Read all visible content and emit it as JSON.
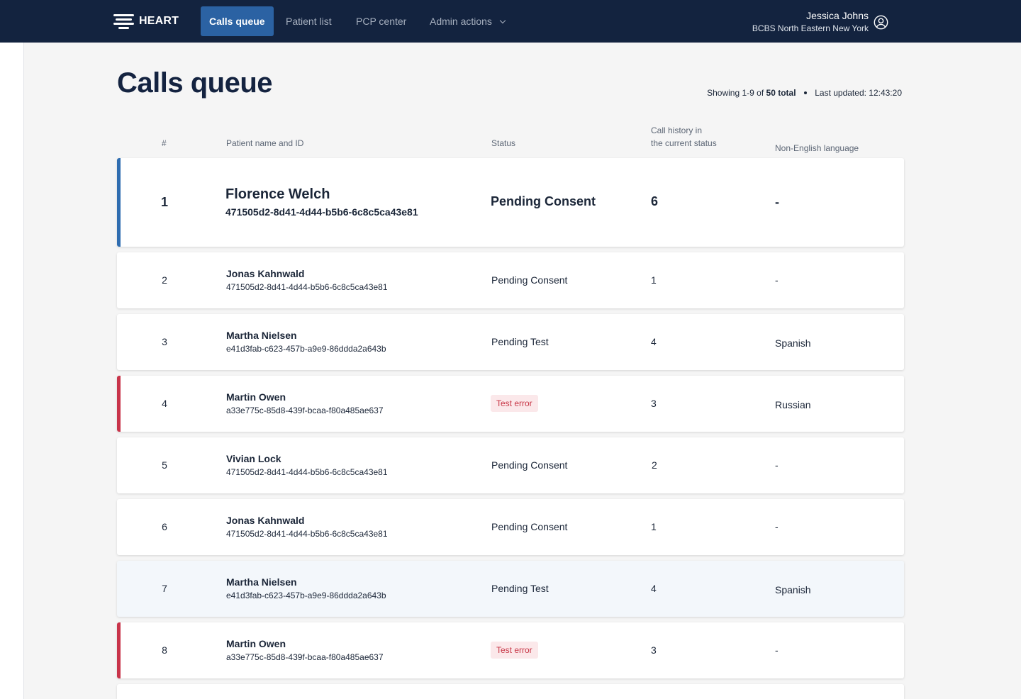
{
  "nav": {
    "brand": "HEART",
    "items": [
      {
        "label": "Calls queue",
        "active": true
      },
      {
        "label": "Patient list",
        "active": false
      },
      {
        "label": "PCP center",
        "active": false
      },
      {
        "label": "Admin actions",
        "active": false
      }
    ]
  },
  "user": {
    "name": "Jessica Johns",
    "org": "BCBS North Eastern New York",
    "icon": "user-circle-icon"
  },
  "page": {
    "title": "Calls queue",
    "summary_prefix": "Showing 1-9 of",
    "summary_total": "50 total",
    "summary_updated": "Last updated: 12:43:20"
  },
  "columns": {
    "num": "#",
    "patient": "Patient name and ID",
    "status": "Status",
    "calls_line1": "Call history in",
    "calls_line2": "the current status",
    "language": "Non-English language"
  },
  "rows": [
    {
      "num": "1",
      "name": "Florence Welch",
      "id": "471505d2-8d41-4d44-b5b6-6c8c5ca43e81",
      "status": "Pending Consent",
      "calls": "6",
      "language": "-"
    },
    {
      "num": "2",
      "name": "Jonas Kahnwald",
      "id": "471505d2-8d41-4d44-b5b6-6c8c5ca43e81",
      "status": "Pending Consent",
      "calls": "1",
      "language": "-"
    },
    {
      "num": "3",
      "name": "Martha Nielsen",
      "id": "e41d3fab-c623-457b-a9e9-86ddda2a643b",
      "status": "Pending Test",
      "calls": "4",
      "language": "Spanish"
    },
    {
      "num": "4",
      "name": "Martin Owen",
      "id": "a33e775c-85d8-439f-bcaa-f80a485ae637",
      "status": "Test error",
      "calls": "3",
      "language": "Russian"
    },
    {
      "num": "5",
      "name": "Vivian Lock",
      "id": "471505d2-8d41-4d44-b5b6-6c8c5ca43e81",
      "status": "Pending Consent",
      "calls": "2",
      "language": "-"
    },
    {
      "num": "6",
      "name": "Jonas Kahnwald",
      "id": "471505d2-8d41-4d44-b5b6-6c8c5ca43e81",
      "status": "Pending Consent",
      "calls": "1",
      "language": "-"
    },
    {
      "num": "7",
      "name": "Martha Nielsen",
      "id": "e41d3fab-c623-457b-a9e9-86ddda2a643b",
      "status": "Pending Test",
      "calls": "4",
      "language": "Spanish"
    },
    {
      "num": "8",
      "name": "Martin Owen",
      "id": "a33e775c-85d8-439f-bcaa-f80a485ae637",
      "status": "Test error",
      "calls": "3",
      "language": "-"
    }
  ],
  "colors": {
    "navbar": "#13233f",
    "active_tab": "#2b62a3",
    "selected_stripe": "#2f6db0",
    "error_stripe": "#c8344a",
    "error_badge_bg": "#fbe8ea",
    "error_badge_text": "#c73545"
  }
}
